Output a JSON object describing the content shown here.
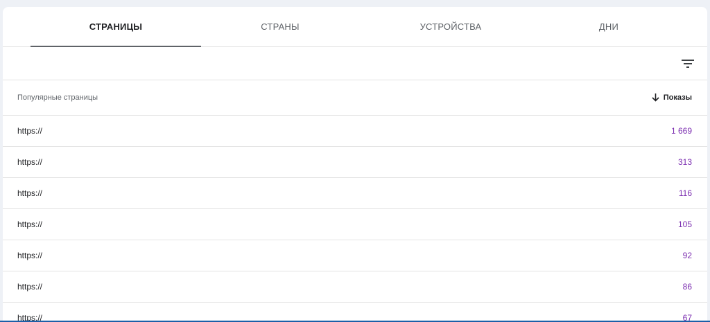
{
  "tabs": [
    {
      "label": "СТРАНИЦЫ",
      "active": true
    },
    {
      "label": "СТРАНЫ",
      "active": false
    },
    {
      "label": "УСТРОЙСТВА",
      "active": false
    },
    {
      "label": "ДНИ",
      "active": false
    }
  ],
  "toolbar": {
    "filter_icon": "filter-list-icon"
  },
  "table": {
    "column_title": "Популярные страницы",
    "sort_icon": "arrow-down-icon",
    "sort_label": "Показы",
    "rows": [
      {
        "url": "https://",
        "impressions": "1 669"
      },
      {
        "url": "https://",
        "impressions": "313"
      },
      {
        "url": "https://",
        "impressions": "116"
      },
      {
        "url": "https://",
        "impressions": "105"
      },
      {
        "url": "https://",
        "impressions": "92"
      },
      {
        "url": "https://",
        "impressions": "86"
      },
      {
        "url": "https://",
        "impressions": "67"
      }
    ]
  },
  "colors": {
    "value_purple": "#7b2db0",
    "tab_indicator": "#5f6368",
    "background": "#eef1f6"
  }
}
